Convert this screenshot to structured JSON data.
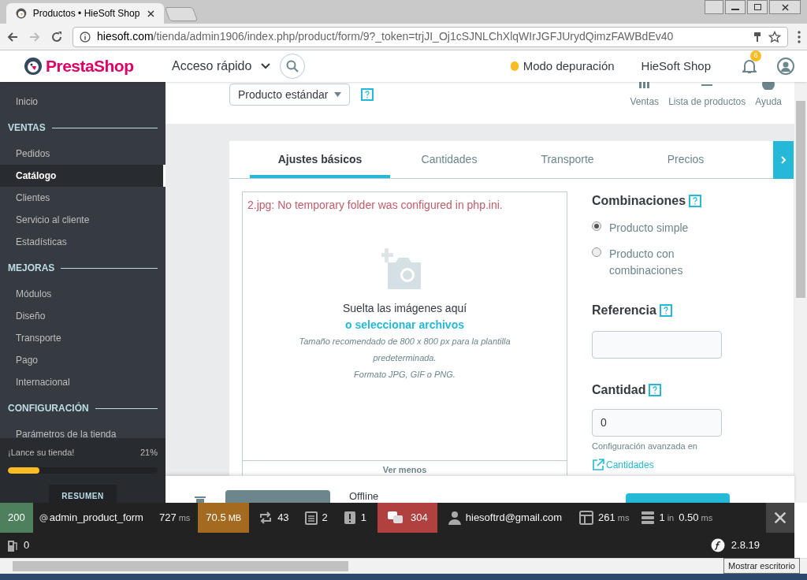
{
  "browser": {
    "tab_title": "Productos • HieSoft Shop",
    "url_host": "hiesoft.com",
    "url_path": "/tienda/admin1906/index.php/product/form/9?_token=trjJI_Oj1cSJNLChXlqWIrJGFJUrydQimzFAWBdEv40"
  },
  "header": {
    "logo": "PrestaShop",
    "quick_access": "Acceso rápido",
    "debug_mode": "Modo depuración",
    "shop_name": "HieSoft Shop",
    "notifications": "6"
  },
  "sidebar": {
    "items": [
      {
        "kind": "item",
        "label": "Inicio",
        "selected": false
      },
      {
        "kind": "section",
        "label": "VENTAS"
      },
      {
        "kind": "item",
        "label": "Pedidos",
        "selected": false
      },
      {
        "kind": "item",
        "label": "Catálogo",
        "selected": true
      },
      {
        "kind": "item",
        "label": "Clientes",
        "selected": false
      },
      {
        "kind": "item",
        "label": "Servicio al cliente",
        "selected": false
      },
      {
        "kind": "item",
        "label": "Estadísticas",
        "selected": false
      },
      {
        "kind": "section",
        "label": "MEJORAS"
      },
      {
        "kind": "item",
        "label": "Módulos",
        "selected": false
      },
      {
        "kind": "item",
        "label": "Diseño",
        "selected": false
      },
      {
        "kind": "item",
        "label": "Transporte",
        "selected": false
      },
      {
        "kind": "item",
        "label": "Pago",
        "selected": false
      },
      {
        "kind": "item",
        "label": "Internacional",
        "selected": false
      },
      {
        "kind": "section",
        "label": "CONFIGURACIÓN"
      },
      {
        "kind": "item",
        "label": "Parámetros de la tienda",
        "selected": false
      }
    ],
    "launch": {
      "label": "¡Lance su tienda!",
      "percent": "21%",
      "level": 0.21
    },
    "summary_button": "RESUMEN"
  },
  "toolbar": {
    "product_type": "Producto estándar",
    "actions": [
      "Ventas",
      "Lista de productos",
      "Ayuda"
    ]
  },
  "tabs": [
    {
      "label": "Ajustes básicos",
      "selected": true
    },
    {
      "label": "Cantidades",
      "selected": false
    },
    {
      "label": "Transporte",
      "selected": false
    },
    {
      "label": "Precios",
      "selected": false
    }
  ],
  "dropzone": {
    "error": "2.jpg: No temporary folder was configured in php.ini.",
    "drop_text": "Suelta las imágenes aquí",
    "select_link": "o seleccionar archivos",
    "hint_lines": [
      "Tamaño recomendado de 800 x 800 px para la plantilla predeterminada.",
      "Formato JPG, GIF o PNG."
    ],
    "toggle": "Ver menos"
  },
  "combinations": {
    "title": "Combinaciones",
    "options": [
      {
        "label": "Producto simple",
        "selected": true
      },
      {
        "label": "Producto con combinaciones",
        "selected": false
      }
    ]
  },
  "reference": {
    "title": "Referencia"
  },
  "quantity": {
    "title": "Cantidad",
    "value": "0",
    "advanced": "Configuración avanzada en",
    "link": "Cantidades"
  },
  "footer": {
    "status": "Offline"
  },
  "debug_bar": {
    "status": "200",
    "route": "admin_product_form",
    "time": "727",
    "time_unit": "ms",
    "memory": "70.5",
    "memory_unit": "MB",
    "items": [
      {
        "kind": "events",
        "value": "43"
      },
      {
        "kind": "forms",
        "value": "2"
      },
      {
        "kind": "exceptions",
        "value": "1"
      }
    ],
    "translations": "304",
    "user": "hiesoftrd@gmail.com",
    "twig": "261",
    "twig_unit": "ms",
    "db": "1",
    "db_in": "in",
    "db_time": "0.50",
    "db_unit": "ms",
    "cache": "0",
    "version": "2.8.19"
  },
  "tooltip": "Mostrar escritorio"
}
